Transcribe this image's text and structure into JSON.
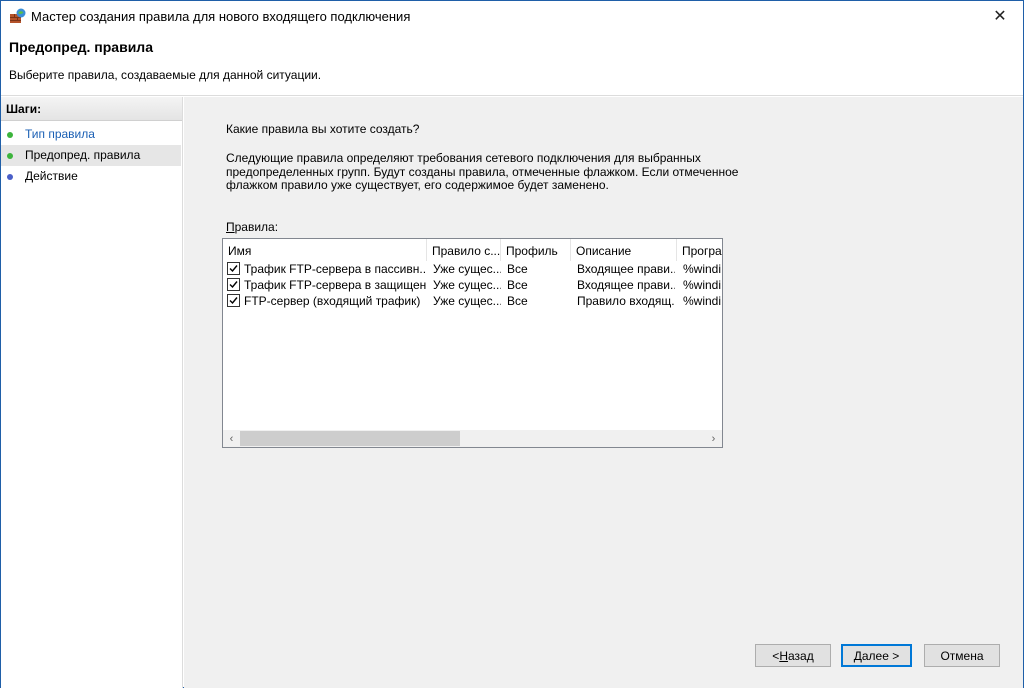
{
  "window": {
    "title": "Мастер создания правила для нового входящего подключения",
    "icon": "firewall-wizard-icon",
    "close_glyph": "✕"
  },
  "header": {
    "title": "Предопред. правила",
    "subtitle": "Выберите правила, создаваемые для данной ситуации."
  },
  "steps": {
    "title": "Шаги:",
    "items": [
      {
        "label": "Тип правила",
        "dot_color": "#3cb43c"
      },
      {
        "label": "Предопред. правила",
        "dot_color": "#3cb43c"
      },
      {
        "label": "Действие",
        "dot_color": "#4a5fc8"
      }
    ]
  },
  "main": {
    "question": "Какие правила вы хотите создать?",
    "description": "Следующие правила определяют требования сетевого подключения для выбранных предопределенных групп. Будут созданы правила, отмеченные флажком. Если отмеченное флажком правило уже существует, его содержимое будет заменено.",
    "rules_label_underlined": "П",
    "rules_label_rest": "равила:"
  },
  "table": {
    "columns": [
      "Имя",
      "Правило с...",
      "Профиль",
      "Описание",
      "Програ"
    ],
    "rows": [
      {
        "checked": true,
        "name": "Трафик FTP-сервера в пассивн...",
        "rule": "Уже сущес...",
        "profile": "Все",
        "description": "Входящее прави...",
        "program": "%windir"
      },
      {
        "checked": true,
        "name": "Трафик FTP-сервера в защищен...",
        "rule": "Уже сущес...",
        "profile": "Все",
        "description": "Входящее прави...",
        "program": "%windir"
      },
      {
        "checked": true,
        "name": "FTP-сервер (входящий трафик)",
        "rule": "Уже сущес...",
        "profile": "Все",
        "description": "Правило входящ...",
        "program": "%windir"
      }
    ]
  },
  "scrollbar": {
    "left_glyph": "‹",
    "right_glyph": "›"
  },
  "buttons": {
    "back_prefix": "< ",
    "back_ul": "Н",
    "back_rest": "азад",
    "next_ul": "Д",
    "next_rest": "алее >",
    "cancel": "Отмена"
  }
}
